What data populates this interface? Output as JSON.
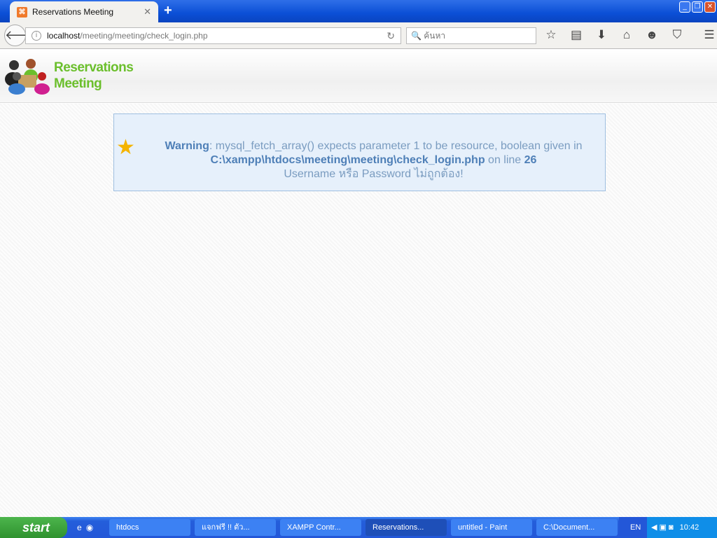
{
  "browser": {
    "tab_title": "Reservations Meeting",
    "url_host": "localhost",
    "url_path": "/meeting/meeting/check_login.php",
    "search_placeholder": "ค้นหา"
  },
  "site": {
    "logo_line1": "Reservations",
    "logo_line2": "Meeting"
  },
  "alert": {
    "warning_label": "Warning",
    "msg1": ": mysql_fetch_array() expects parameter 1 to be resource, boolean given in ",
    "file": "C:\\xampp\\htdocs\\meeting\\meeting\\check_login.php",
    "msg2": " on line ",
    "line": "26",
    "msg3": "Username หรือ Password ไม่ถูกต้อง!"
  },
  "taskbar": {
    "start": "start",
    "items": [
      "htdocs",
      "แจกฟรี !! ตัว...",
      "XAMPP Contr...",
      "Reservations...",
      "untitled - Paint",
      "C:\\Document..."
    ],
    "lang": "EN",
    "clock": "10:42"
  }
}
